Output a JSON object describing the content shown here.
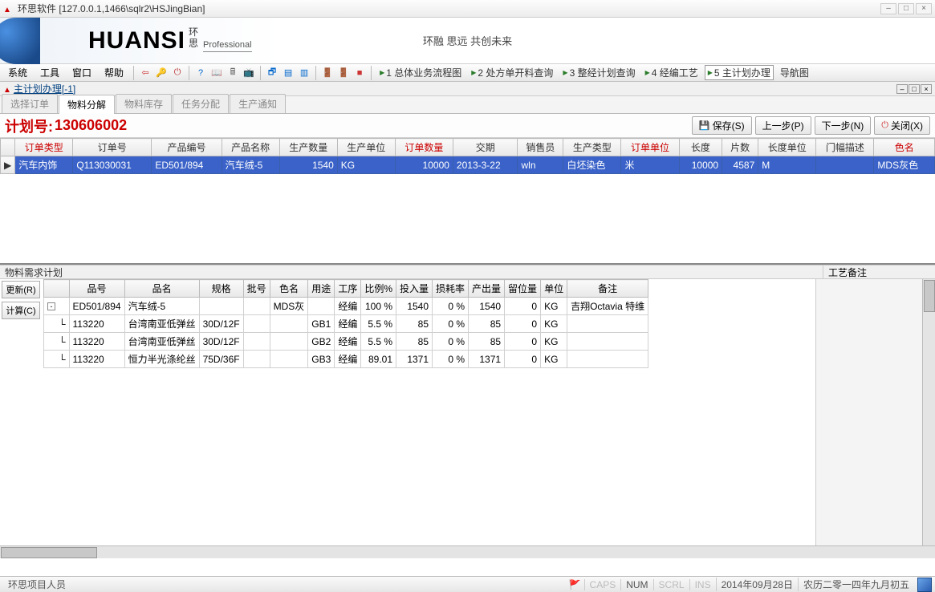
{
  "window": {
    "title": "环思软件  [127.0.0.1,1466\\sqlr2\\HSJingBian]",
    "min": "–",
    "max": "□",
    "close": "×"
  },
  "banner": {
    "logo": "HUANSI",
    "logo_cn_top": "环",
    "logo_cn_bot": "思",
    "sub": "Professional",
    "slogan": "环融 思远 共创未来"
  },
  "menu": {
    "items": [
      "系统",
      "工具",
      "窗口",
      "帮助"
    ],
    "nav": [
      {
        "label": "1 总体业务流程图"
      },
      {
        "label": "2 处方单开料查询"
      },
      {
        "label": "3 整经计划查询"
      },
      {
        "label": "4 经编工艺"
      },
      {
        "label": "5 主计划办理",
        "active": true
      },
      {
        "label": "导航图"
      }
    ]
  },
  "subtitle": {
    "text": "主计划办理[-1]"
  },
  "tabs": [
    "选择订单",
    "物料分解",
    "物料库存",
    "任务分配",
    "生产通知"
  ],
  "active_tab": "物料分解",
  "plan": {
    "label": "计划号:",
    "number": "130606002",
    "buttons": {
      "save": "保存(S)",
      "prev": "上一步(P)",
      "next": "下一步(N)",
      "close": "关闭(X)"
    }
  },
  "grid1": {
    "headers": [
      {
        "t": "订单类型",
        "red": true
      },
      {
        "t": "订单号"
      },
      {
        "t": "产品编号"
      },
      {
        "t": "产品名称"
      },
      {
        "t": "生产数量"
      },
      {
        "t": "生产单位"
      },
      {
        "t": "订单数量",
        "red": true
      },
      {
        "t": "交期"
      },
      {
        "t": "销售员"
      },
      {
        "t": "生产类型"
      },
      {
        "t": "订单单位",
        "red": true
      },
      {
        "t": "长度"
      },
      {
        "t": "片数"
      },
      {
        "t": "长度单位"
      },
      {
        "t": "门幅描述"
      },
      {
        "t": "色名",
        "red": true
      }
    ],
    "row": {
      "order_type": "汽车内饰",
      "order_no": "Q113030031",
      "prod_code": "ED501/894",
      "prod_name": "汽车绒-5",
      "prod_qty": "1540",
      "prod_unit": "KG",
      "order_qty": "10000",
      "due": "2013-3-22",
      "sales": "wln",
      "prod_type": "白坯染色",
      "order_unit": "米",
      "length": "10000",
      "pieces": "4587",
      "len_unit": "M",
      "width_desc": "",
      "color": "MDS灰色"
    }
  },
  "split": {
    "left": "物料需求计划",
    "right": "工艺备注"
  },
  "side_btns": {
    "refresh": "更新(R)",
    "calc": "计算(C)"
  },
  "grid2": {
    "headers": [
      "",
      "品号",
      "品名",
      "规格",
      "批号",
      "色名",
      "用途",
      "工序",
      "比例%",
      "投入量",
      "损耗率",
      "产出量",
      "留位量",
      "单位",
      "备注"
    ],
    "rows": [
      {
        "tree": "-",
        "code": "ED501/894",
        "name": "汽车绒-5",
        "spec": "",
        "batch": "",
        "color": "MDS灰",
        "use": "",
        "proc": "经编",
        "ratio": "100 %",
        "input": "1540",
        "loss": "0 %",
        "output": "1540",
        "reserve": "0",
        "unit": "KG",
        "remark": "吉翔Octavia 特维"
      },
      {
        "tree": "",
        "code": "113220",
        "name": "台湾南亚低弹丝",
        "spec": "30D/12F",
        "batch": "",
        "color": "",
        "use": "GB1",
        "proc": "经编",
        "ratio": "5.5 %",
        "input": "85",
        "loss": "0 %",
        "output": "85",
        "reserve": "0",
        "unit": "KG",
        "remark": ""
      },
      {
        "tree": "",
        "code": "113220",
        "name": "台湾南亚低弹丝",
        "spec": "30D/12F",
        "batch": "",
        "color": "",
        "use": "GB2",
        "proc": "经编",
        "ratio": "5.5 %",
        "input": "85",
        "loss": "0 %",
        "output": "85",
        "reserve": "0",
        "unit": "KG",
        "remark": ""
      },
      {
        "tree": "",
        "code": "113220",
        "name": "恒力半光涤纶丝",
        "spec": "75D/36F",
        "batch": "",
        "color": "",
        "use": "GB3",
        "proc": "经编",
        "ratio": "89.01",
        "input": "1371",
        "loss": "0 %",
        "output": "1371",
        "reserve": "0",
        "unit": "KG",
        "remark": ""
      }
    ]
  },
  "status": {
    "user": "环思项目人员",
    "caps": "CAPS",
    "num": "NUM",
    "scrl": "SCRL",
    "ins": "INS",
    "date": "2014年09月28日",
    "lunar": "农历二零一四年九月初五"
  }
}
